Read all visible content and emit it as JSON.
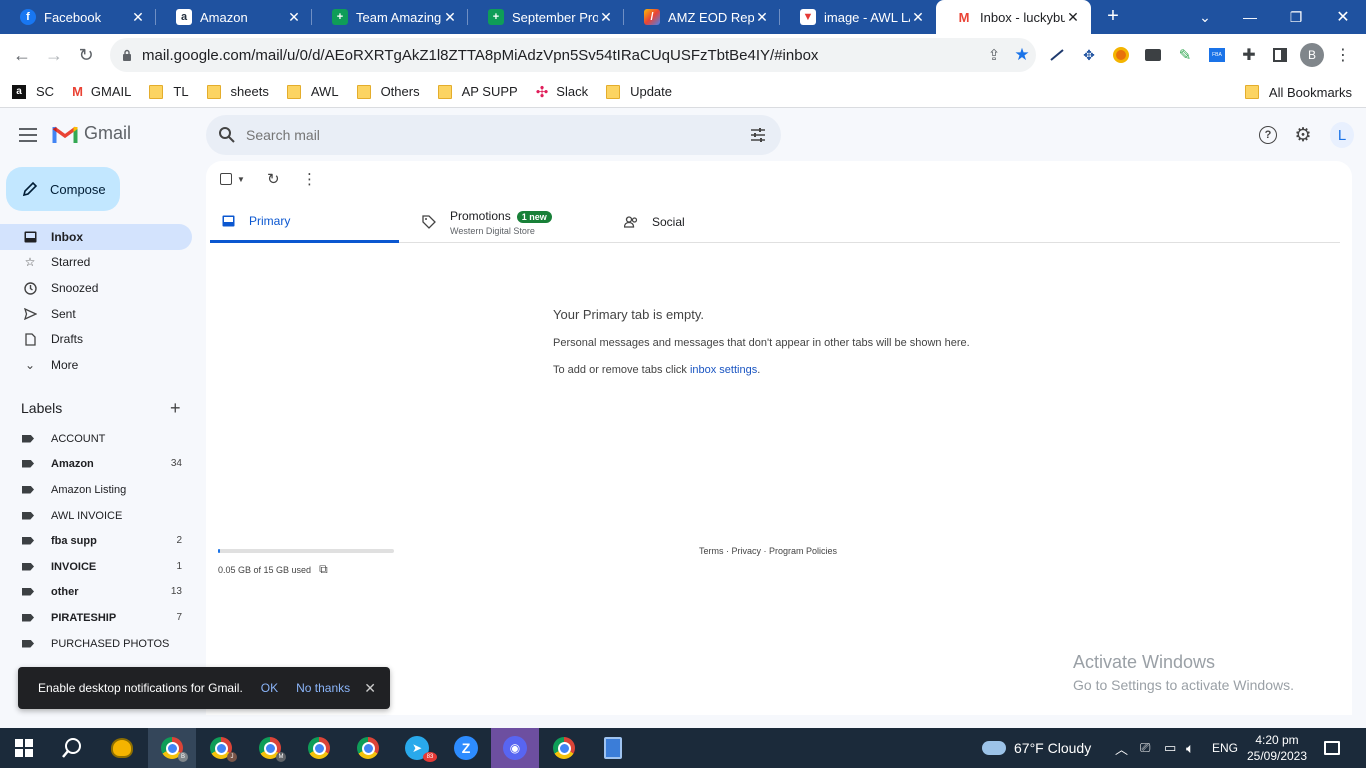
{
  "browser": {
    "tabs": [
      {
        "title": "Facebook",
        "icon": "facebook-icon",
        "color": "#1877f2"
      },
      {
        "title": "Amazon",
        "icon": "amazon-icon",
        "color": "#232f3e"
      },
      {
        "title": "Team Amazing P",
        "icon": "sheets-icon",
        "color": "#0f9d58"
      },
      {
        "title": "September Profi",
        "icon": "sheets-icon",
        "color": "#0f9d58"
      },
      {
        "title": "AMZ EOD Repor",
        "icon": "pen-icon",
        "color": "#ea4335"
      },
      {
        "title": "image - AWL LA",
        "icon": "image-icon",
        "color": "#e53935"
      },
      {
        "title": "Inbox - luckybuc",
        "icon": "gmail-icon",
        "color": "#ea4335"
      }
    ],
    "url": "mail.google.com/mail/u/0/d/AEoRXRTgAkZ1l8ZTTA8pMiAdzVpn5Sv54tIRaCUqUSFzTbtBe4IY/#inbox",
    "profile_initial": "B",
    "bookmarks": [
      {
        "label": "SC",
        "icon": "amazon-icon"
      },
      {
        "label": "GMAIL",
        "icon": "gmail-icon"
      },
      {
        "label": "TL",
        "icon": "folder-icon"
      },
      {
        "label": "sheets",
        "icon": "folder-icon"
      },
      {
        "label": "AWL",
        "icon": "folder-icon"
      },
      {
        "label": "Others",
        "icon": "folder-icon"
      },
      {
        "label": "AP SUPP",
        "icon": "folder-icon"
      },
      {
        "label": "Slack",
        "icon": "slack-icon"
      },
      {
        "label": "Update",
        "icon": "folder-icon"
      }
    ],
    "all_bookmarks": "All Bookmarks"
  },
  "gmail": {
    "logo_text": "Gmail",
    "search_placeholder": "Search mail",
    "avatar_initial": "L",
    "compose_label": "Compose",
    "nav": [
      {
        "label": "Inbox",
        "icon": "inbox-icon",
        "active": true
      },
      {
        "label": "Starred",
        "icon": "star-icon"
      },
      {
        "label": "Snoozed",
        "icon": "clock-icon"
      },
      {
        "label": "Sent",
        "icon": "send-icon"
      },
      {
        "label": "Drafts",
        "icon": "draft-icon"
      },
      {
        "label": "More",
        "icon": "chevron-down-icon"
      }
    ],
    "labels_title": "Labels",
    "labels": [
      {
        "name": "ACCOUNT",
        "count": "",
        "bold": false
      },
      {
        "name": "Amazon",
        "count": "34",
        "bold": true
      },
      {
        "name": "Amazon Listing",
        "count": "",
        "bold": false
      },
      {
        "name": "AWL INVOICE",
        "count": "",
        "bold": false
      },
      {
        "name": "fba supp",
        "count": "2",
        "bold": true
      },
      {
        "name": "INVOICE",
        "count": "1",
        "bold": true
      },
      {
        "name": "other",
        "count": "13",
        "bold": true
      },
      {
        "name": "PIRATESHIP",
        "count": "7",
        "bold": true
      },
      {
        "name": "PURCHASED PHOTOS",
        "count": "",
        "bold": false
      }
    ],
    "inbox_tabs": {
      "primary": "Primary",
      "promotions": "Promotions",
      "promotions_badge": "1 new",
      "promotions_sub": "Western Digital Store",
      "social": "Social"
    },
    "empty_state": {
      "title": "Your Primary tab is empty.",
      "description": "Personal messages and messages that don't appear in other tabs will be shown here.",
      "settings_prefix": "To add or remove tabs click ",
      "settings_link": "inbox settings",
      "settings_suffix": "."
    },
    "storage": {
      "text": "0.05 GB of 15 GB used",
      "fraction": 0.0033
    },
    "footer": "Terms · Privacy · Program Policies",
    "snackbar": {
      "message": "Enable desktop notifications for Gmail.",
      "ok": "OK",
      "no_thanks": "No thanks"
    }
  },
  "windows": {
    "activate_title": "Activate Windows",
    "activate_sub": "Go to Settings to activate Windows.",
    "weather": "67°F  Cloudy",
    "language": "ENG",
    "time": "4:20 pm",
    "date": "25/09/2023",
    "telegram_badge": "83"
  },
  "colors": {
    "chrome_blue": "#1f52a0",
    "gmail_compose": "#c2e7ff",
    "gmail_active_nav": "#d3e3fd",
    "primary_tab": "#0b57d0",
    "taskbar": "#1b2a3a"
  }
}
